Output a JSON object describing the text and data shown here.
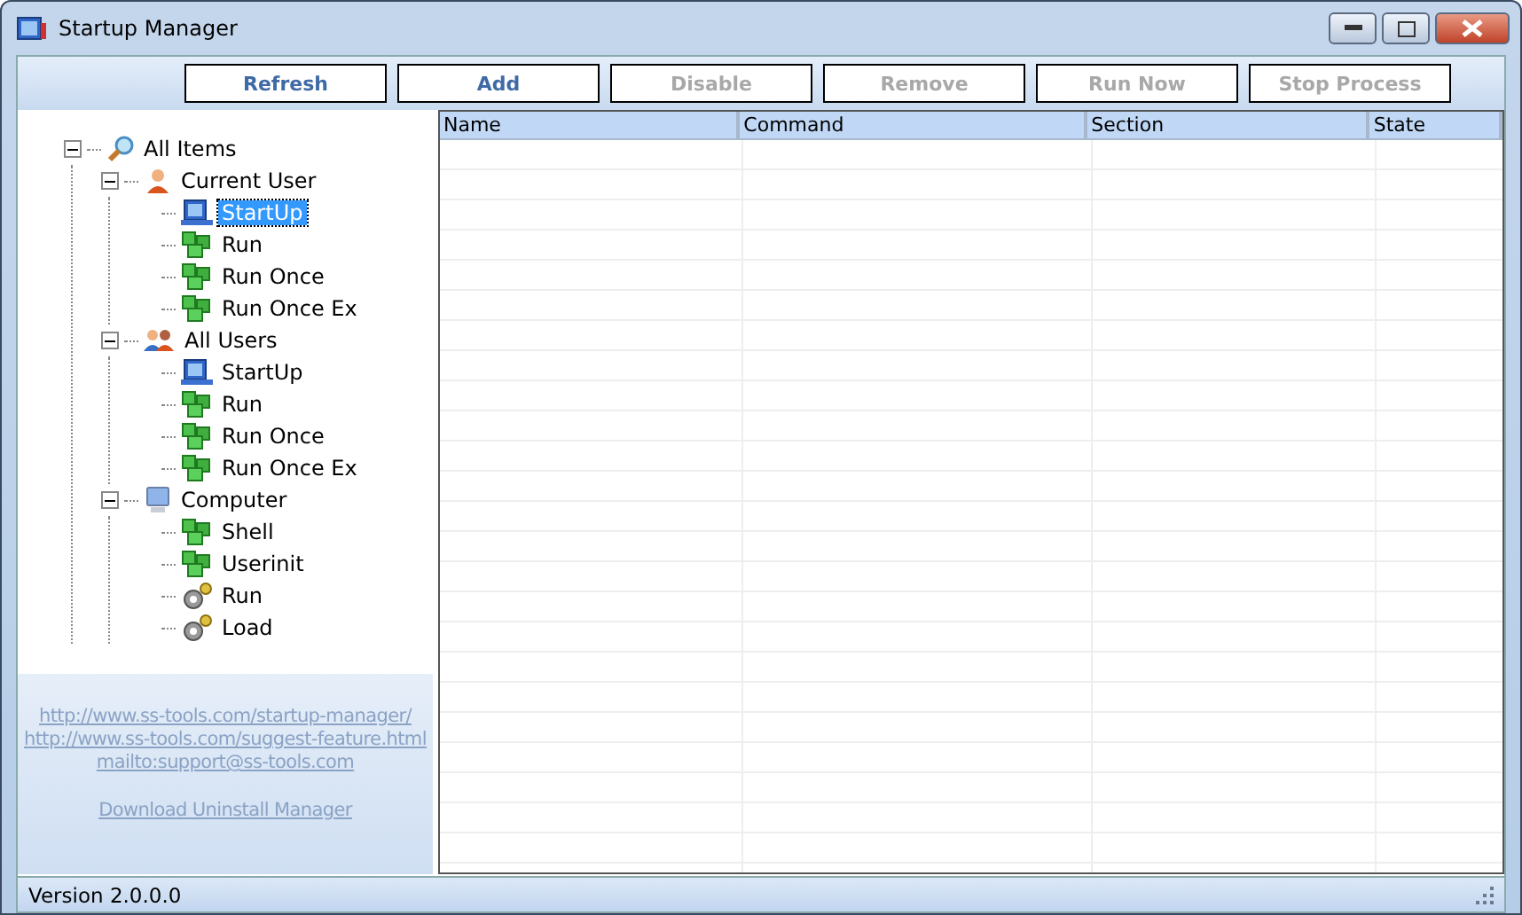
{
  "window": {
    "title": "Startup Manager"
  },
  "toolbar": [
    {
      "label": "Refresh",
      "disabled": false
    },
    {
      "label": "Add",
      "disabled": false
    },
    {
      "label": "Disable",
      "disabled": true
    },
    {
      "label": "Remove",
      "disabled": true
    },
    {
      "label": "Run Now",
      "disabled": true
    },
    {
      "label": "Stop Process",
      "disabled": true
    }
  ],
  "tree": [
    {
      "label": "All Items",
      "kind": "search",
      "selected": false,
      "expanded": true,
      "children": [
        {
          "label": "Current User",
          "kind": "user",
          "selected": false,
          "expanded": true,
          "children": [
            {
              "label": "StartUp",
              "kind": "startup",
              "selected": true
            },
            {
              "label": "Run",
              "kind": "registry",
              "selected": false
            },
            {
              "label": "Run Once",
              "kind": "registry",
              "selected": false
            },
            {
              "label": "Run Once Ex",
              "kind": "registry",
              "selected": false
            }
          ]
        },
        {
          "label": "All Users",
          "kind": "users",
          "selected": false,
          "expanded": true,
          "children": [
            {
              "label": "StartUp",
              "kind": "startup",
              "selected": false
            },
            {
              "label": "Run",
              "kind": "registry",
              "selected": false
            },
            {
              "label": "Run Once",
              "kind": "registry",
              "selected": false
            },
            {
              "label": "Run Once Ex",
              "kind": "registry",
              "selected": false
            }
          ]
        },
        {
          "label": "Computer",
          "kind": "computer",
          "selected": false,
          "expanded": true,
          "children": [
            {
              "label": "Shell",
              "kind": "registry",
              "selected": false
            },
            {
              "label": "Userinit",
              "kind": "registry",
              "selected": false
            },
            {
              "label": "Run",
              "kind": "gear",
              "selected": false
            },
            {
              "label": "Load",
              "kind": "gear",
              "selected": false
            }
          ]
        }
      ]
    }
  ],
  "links": [
    "http://www.ss-tools.com/startup-manager/",
    "http://www.ss-tools.com/suggest-feature.html",
    "mailto:support@ss-tools.com",
    "Download Uninstall Manager"
  ],
  "table": {
    "columns": [
      "Name",
      "Command",
      "Section",
      "State"
    ]
  },
  "status_bar": {
    "text": "Version 2.0.0.0"
  }
}
